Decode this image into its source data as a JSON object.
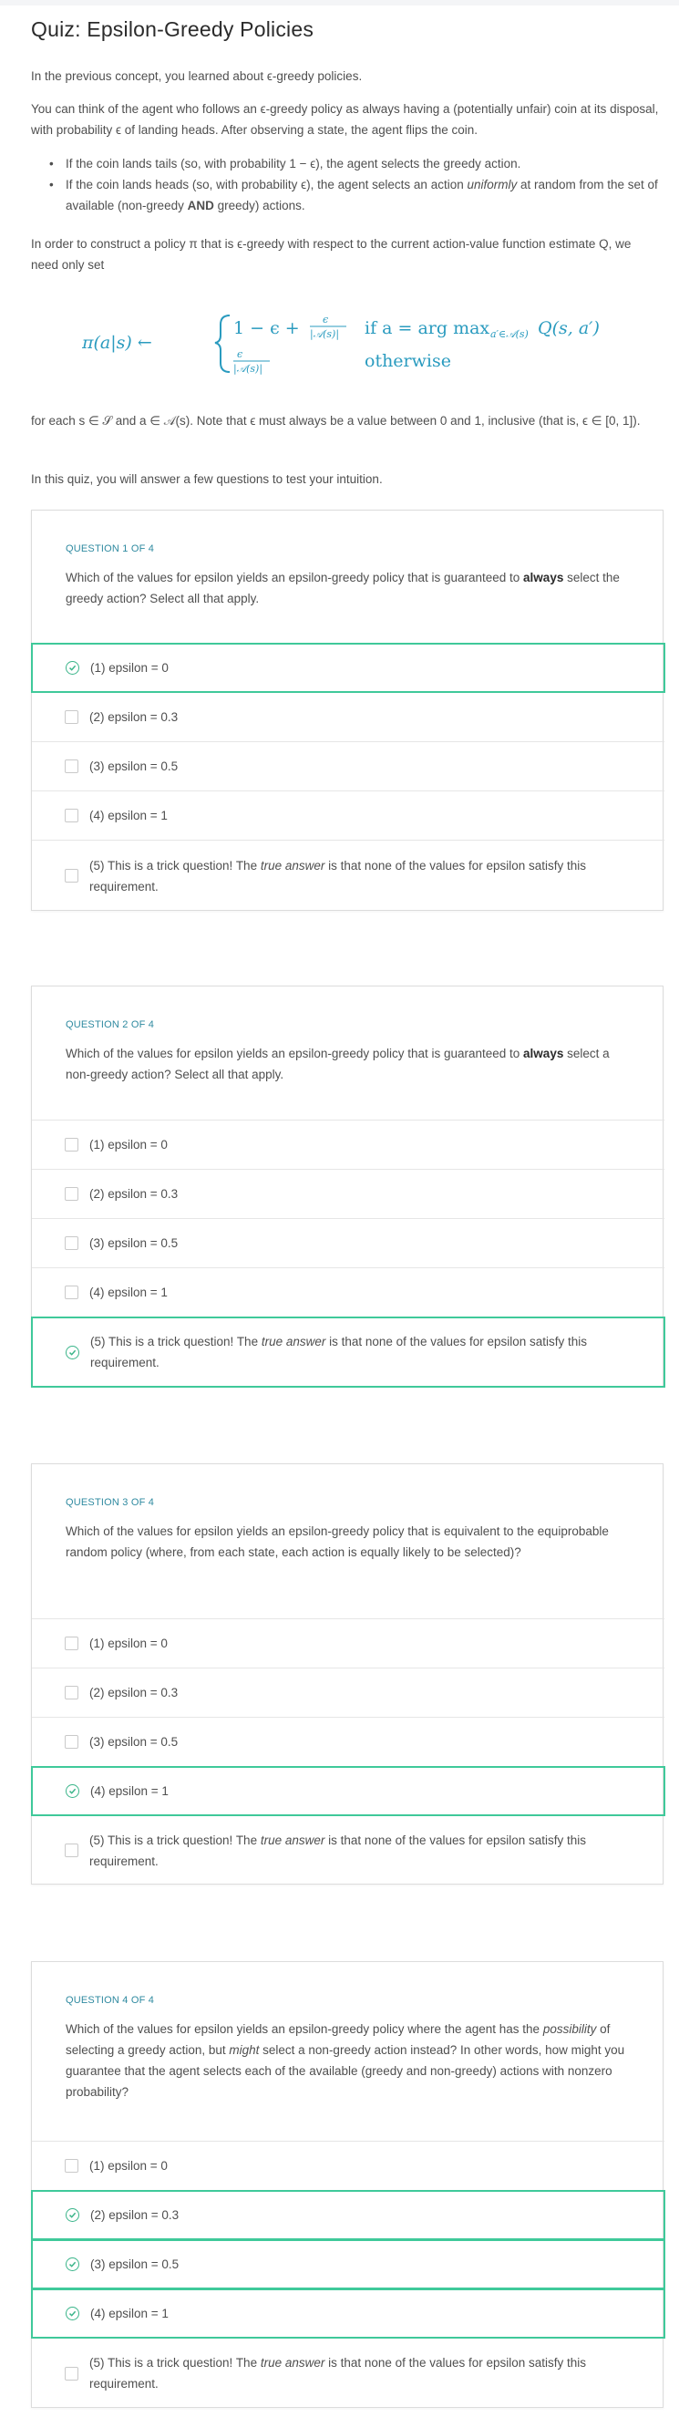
{
  "title": "Quiz: Epsilon-Greedy Policies",
  "intro": {
    "p1": "In the previous concept, you learned about ϵ-greedy policies.",
    "p2": "You can think of the agent who follows an ϵ-greedy policy as always having a (potentially unfair) coin at its disposal, with probability ϵ of landing heads. After observing a state, the agent flips the coin.",
    "bullet1": "If the coin lands tails (so, with probability 1 − ϵ), the agent selects the greedy action.",
    "bullet2_a": "If the coin lands heads (so, with probability ϵ), the agent selects an action ",
    "bullet2_em": "uniformly",
    "bullet2_b": " at random from the set of available (non-greedy ",
    "bullet2_bold": "AND",
    "bullet2_c": " greedy) actions.",
    "p3": "In order to construct a policy π that is ϵ-greedy with respect to the current action-value function estimate Q, we need only set",
    "formula": {
      "lhs": "π(a|s) ←",
      "case1_a": "1 − ϵ +",
      "frac_num": "ϵ",
      "frac_den": "|𝒜(s)|",
      "case1_cond": "if a = arg max",
      "case1_sub": "a′∈𝒜(s)",
      "case1_q": "Q(s, a′)",
      "case2_cond": "otherwise"
    },
    "p4": "for each s ∈ 𝒮 and a ∈ 𝒜(s). Note that ϵ must always be a value between 0 and 1, inclusive (that is, ϵ ∈ [0, 1]).",
    "p5": "In this quiz, you will answer a few questions to test your intuition."
  },
  "questions": [
    {
      "label": "QUESTION 1 OF 4",
      "text_a": "Which of the values for epsilon yields an epsilon-greedy policy that is guaranteed to ",
      "text_bold": "always",
      "text_b": " select the greedy action? Select all that apply.",
      "options": [
        {
          "label": "(1) epsilon = 0",
          "selected": true
        },
        {
          "label": "(2) epsilon = 0.3",
          "selected": false
        },
        {
          "label": "(3) epsilon = 0.5",
          "selected": false
        },
        {
          "label": "(4) epsilon = 1",
          "selected": false
        },
        {
          "label_a": "(5) This is a trick question! The ",
          "label_em": "true answer",
          "label_b": " is that none of the values for epsilon satisfy this requirement.",
          "selected": false
        }
      ]
    },
    {
      "label": "QUESTION 2 OF 4",
      "text_a": "Which of the values for epsilon yields an epsilon-greedy policy that is guaranteed to ",
      "text_bold": "always",
      "text_b": " select a non-greedy action? Select all that apply.",
      "options": [
        {
          "label": "(1) epsilon = 0",
          "selected": false
        },
        {
          "label": "(2) epsilon = 0.3",
          "selected": false
        },
        {
          "label": "(3) epsilon = 0.5",
          "selected": false
        },
        {
          "label": "(4) epsilon = 1",
          "selected": false
        },
        {
          "label_a": "(5) This is a trick question! The ",
          "label_em": "true answer",
          "label_b": " is that none of the values for epsilon satisfy this requirement.",
          "selected": true
        }
      ]
    },
    {
      "label": "QUESTION 3 OF 4",
      "text": "Which of the values for epsilon yields an epsilon-greedy policy that is equivalent to the equiprobable random policy (where, from each state, each action is equally likely to be selected)?",
      "options": [
        {
          "label": "(1) epsilon = 0",
          "selected": false
        },
        {
          "label": "(2) epsilon = 0.3",
          "selected": false
        },
        {
          "label": "(3) epsilon = 0.5",
          "selected": false
        },
        {
          "label": "(4) epsilon = 1",
          "selected": true
        },
        {
          "label_a": "(5) This is a trick question! The ",
          "label_em": "true answer",
          "label_b": " is that none of the values for epsilon satisfy this requirement.",
          "selected": false
        }
      ]
    },
    {
      "label": "QUESTION 4 OF 4",
      "text_a": "Which of the values for epsilon yields an epsilon-greedy policy where the agent has the ",
      "text_em1": "possibility",
      "text_b": " of selecting a greedy action, but ",
      "text_em2": "might",
      "text_c": " select a non-greedy action instead? In other words, how might you guarantee that the agent selects each of the available (greedy and non-greedy) actions with nonzero probability?",
      "options": [
        {
          "label": "(1) epsilon = 0",
          "selected": false
        },
        {
          "label": "(2) epsilon = 0.3",
          "selected": true
        },
        {
          "label": "(3) epsilon = 0.5",
          "selected": true
        },
        {
          "label": "(4) epsilon = 1",
          "selected": true
        },
        {
          "label_a": "(5) This is a trick question! The ",
          "label_em": "true answer",
          "label_b": " is that none of the values for epsilon satisfy this requirement.",
          "selected": false
        }
      ]
    }
  ],
  "colors": {
    "accent": "#3fc99a",
    "label": "#2f8aa0",
    "formula": "#2a9bbf"
  },
  "icons": {
    "selected": "check-circle-icon",
    "unselected": "checkbox-icon"
  }
}
